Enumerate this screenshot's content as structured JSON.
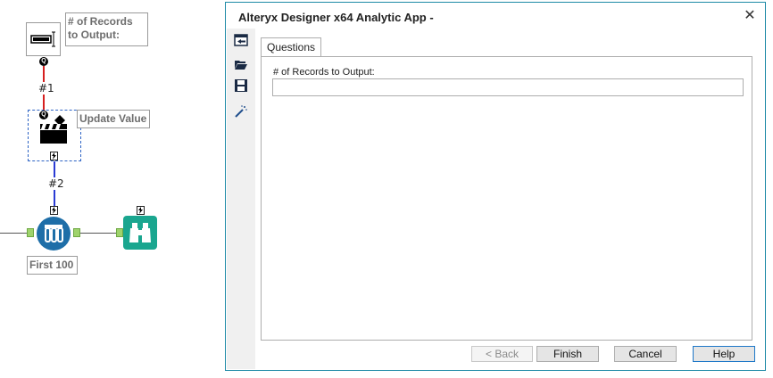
{
  "workflow": {
    "numeric_up_down": {
      "annotation": "# of Records to Output:"
    },
    "action_tool": {
      "annotation": "Update Value"
    },
    "sample_tool": {
      "annotation": "First 100"
    },
    "connections": {
      "first": "#1",
      "second": "#2"
    },
    "anchors": {
      "question_letter": "Q"
    },
    "colors": {
      "question_wire": "#d61f1f",
      "action_wire": "#2a3bd4",
      "sample_tool": "#1e6ea8",
      "browse_tool": "#1aa68f"
    }
  },
  "dialog": {
    "title": "Alteryx Designer x64 Analytic App -",
    "close_glyph": "✕",
    "rail_icons": [
      "back-to-designer-icon",
      "open-folder-icon",
      "save-icon",
      "magic-wand-icon"
    ],
    "tabs": [
      {
        "label": "Questions"
      }
    ],
    "questions": [
      {
        "label": "# of Records to Output:",
        "value": ""
      }
    ],
    "buttons": {
      "back": "< Back",
      "finish": "Finish",
      "cancel": "Cancel",
      "help": "Help"
    },
    "colors": {
      "border": "#1e8aa6"
    }
  }
}
